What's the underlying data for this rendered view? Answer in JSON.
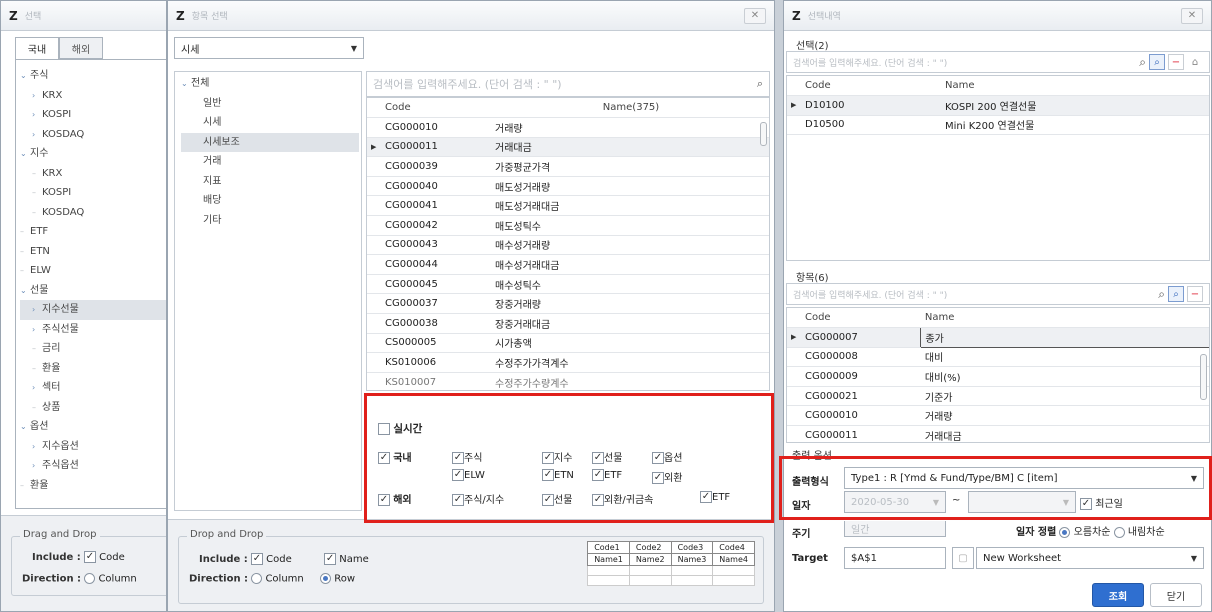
{
  "panel1": {
    "title": "선택",
    "tabs": [
      "국내",
      "해외"
    ],
    "tree": [
      {
        "label": "주식",
        "level": 0,
        "twisty": "⌄"
      },
      {
        "label": "KRX",
        "level": 1,
        "twisty": "›"
      },
      {
        "label": "KOSPI",
        "level": 1,
        "twisty": "›"
      },
      {
        "label": "KOSDAQ",
        "level": 1,
        "twisty": "›"
      },
      {
        "label": "지수",
        "level": 0,
        "twisty": "⌄"
      },
      {
        "label": "KRX",
        "level": 1,
        "twisty": ""
      },
      {
        "label": "KOSPI",
        "level": 1,
        "twisty": ""
      },
      {
        "label": "KOSDAQ",
        "level": 1,
        "twisty": ""
      },
      {
        "label": "ETF",
        "level": 0,
        "twisty": ""
      },
      {
        "label": "ETN",
        "level": 0,
        "twisty": ""
      },
      {
        "label": "ELW",
        "level": 0,
        "twisty": ""
      },
      {
        "label": "선물",
        "level": 0,
        "twisty": "⌄"
      },
      {
        "label": "지수선물",
        "level": 1,
        "twisty": "›",
        "selected": true
      },
      {
        "label": "주식선물",
        "level": 1,
        "twisty": "›"
      },
      {
        "label": "금리",
        "level": 1,
        "twisty": ""
      },
      {
        "label": "환율",
        "level": 1,
        "twisty": ""
      },
      {
        "label": "섹터",
        "level": 1,
        "twisty": "›"
      },
      {
        "label": "상품",
        "level": 1,
        "twisty": ""
      },
      {
        "label": "옵션",
        "level": 0,
        "twisty": "⌄"
      },
      {
        "label": "지수옵션",
        "level": 1,
        "twisty": "›"
      },
      {
        "label": "주식옵션",
        "level": 1,
        "twisty": "›"
      },
      {
        "label": "환율",
        "level": 0,
        "twisty": ""
      }
    ],
    "footer": {
      "legend": "Drag and Drop",
      "include_label": "Include :",
      "code_label": "Code",
      "direction_label": "Direction :",
      "column_label": "Column"
    }
  },
  "panel2": {
    "title": "항목 선택",
    "category": "시세",
    "tree": [
      {
        "label": "전체",
        "level": 0,
        "twisty": "⌄"
      },
      {
        "label": "일반",
        "level": 1
      },
      {
        "label": "시세",
        "level": 1
      },
      {
        "label": "시세보조",
        "level": 1,
        "selected": true
      },
      {
        "label": "거래",
        "level": 1
      },
      {
        "label": "지표",
        "level": 1
      },
      {
        "label": "배당",
        "level": 1
      },
      {
        "label": "기타",
        "level": 1
      }
    ],
    "search_placeholder": "검색어를 입력해주세요. (단어 검색 : \" \")",
    "grid": {
      "headers": [
        "Code",
        "Name(375)"
      ],
      "rows": [
        [
          "CG000010",
          "거래량"
        ],
        [
          "CG000011",
          "거래대금"
        ],
        [
          "CG000039",
          "가중평균가격"
        ],
        [
          "CG000040",
          "매도성거래량"
        ],
        [
          "CG000041",
          "매도성거래대금"
        ],
        [
          "CG000042",
          "매도성틱수"
        ],
        [
          "CG000043",
          "매수성거래량"
        ],
        [
          "CG000044",
          "매수성거래대금"
        ],
        [
          "CG000045",
          "매수성틱수"
        ],
        [
          "CG000037",
          "장중거래량"
        ],
        [
          "CG000038",
          "장중거래대금"
        ],
        [
          "CS000005",
          "시가총액"
        ],
        [
          "KS010006",
          "수정주가가격계수"
        ],
        [
          "KS010007",
          "수정주가수량계수"
        ]
      ],
      "selected_row": 1
    },
    "realtime": "실시간",
    "domestic": {
      "label": "국내",
      "items": [
        "주식",
        "지수",
        "선물",
        "옵션",
        "ELW",
        "ETN",
        "ETF",
        "외환"
      ]
    },
    "overseas": {
      "label": "해외",
      "items": [
        "주식/지수",
        "선물",
        "외환/귀금속",
        "ETF"
      ]
    },
    "footer": {
      "legend": "Drop and Drop",
      "include_label": "Include :",
      "code_label": "Code",
      "name_label": "Name",
      "direction_label": "Direction :",
      "column_label": "Column",
      "row_label": "Row",
      "preview": [
        [
          "Code1",
          "Code2",
          "Code3",
          "Code4"
        ],
        [
          "Name1",
          "Name2",
          "Name3",
          "Name4"
        ]
      ]
    }
  },
  "panel3": {
    "title": "선택내역",
    "sel_label": "선택(2)",
    "search_placeholder": "검색어를 입력해주세요. (단어 검색 : \" \")",
    "sel_grid": {
      "headers": [
        "Code",
        "Name"
      ],
      "rows": [
        [
          "D10100",
          "KOSPI 200 연결선물"
        ],
        [
          "D10500",
          "Mini K200 연결선물"
        ]
      ]
    },
    "item_label": "항목(6)",
    "item_grid": {
      "headers": [
        "Code",
        "Name"
      ],
      "rows": [
        [
          "CG000007",
          "종가"
        ],
        [
          "CG000008",
          "대비"
        ],
        [
          "CG000009",
          "대비(%)"
        ],
        [
          "CG000021",
          "기준가"
        ],
        [
          "CG000010",
          "거래량"
        ],
        [
          "CG000011",
          "거래대금"
        ]
      ]
    },
    "options_label": "출력 옵션",
    "output_format_label": "출력형식",
    "output_format_value": "Type1 : R [Ymd & Fund/Type/BM] C [item]",
    "date_label": "일자",
    "date_from": "2020-05-30",
    "date_sep": "~",
    "recent_label": "최근일",
    "period_label": "주기",
    "period_value": "일간",
    "date_sort_label": "일자 정렬",
    "sort_asc": "오름차순",
    "sort_desc": "내림차순",
    "target_label": "Target",
    "target_value": "$A$1",
    "target_sheet": "New Worksheet",
    "query_button": "조회",
    "close_button": "닫기"
  }
}
